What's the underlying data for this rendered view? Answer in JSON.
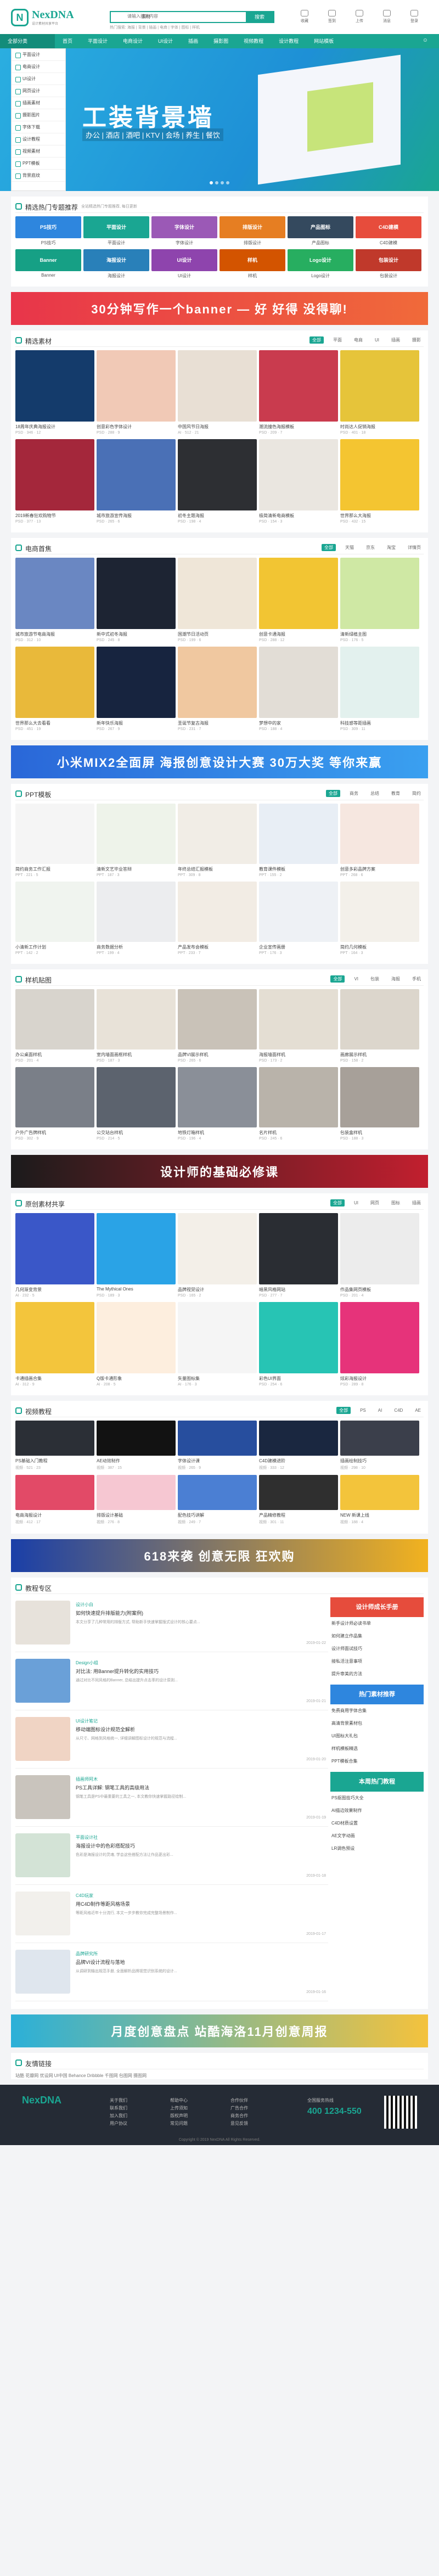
{
  "header": {
    "logo_mark": "N",
    "logo_name": "NexDNA",
    "logo_tagline": "设计素材共享平台",
    "search_category": "素材",
    "search_placeholder": "请输入搜索内容",
    "search_button": "搜索",
    "hot_words": "热门搜索: 海报 | 背景 | 插画 | 电商 | 字体 | 图标 | 样机",
    "tools": [
      "收藏",
      "签到",
      "上传",
      "消息",
      "登录"
    ]
  },
  "nav": {
    "items": [
      "全部分类",
      "首页",
      "平面设计",
      "电商设计",
      "UI设计",
      "插画",
      "摄影图",
      "视频教程",
      "设计教程",
      "网站模板"
    ],
    "right_icon": "user-icon"
  },
  "hero": {
    "dropdown": [
      "平面设计",
      "电商设计",
      "UI设计",
      "网页设计",
      "插画素材",
      "摄影图片",
      "字体下载",
      "设计教程",
      "视频素材",
      "PPT模板",
      "背景底纹"
    ],
    "title": "工装背景墙",
    "subtitle": "办公 | 酒店 | 酒吧 | KTV | 会场 | 养生 | 餐饮"
  },
  "sections": {
    "top_cats": {
      "title": "精选热门专题推荐",
      "note": "全站精选热门专题推荐, 每日更新",
      "items": [
        {
          "label": "PS技巧",
          "color": "#2e86de"
        },
        {
          "label": "平面设计",
          "color": "#1aa692"
        },
        {
          "label": "字体设计",
          "color": "#9b59b6"
        },
        {
          "label": "排版设计",
          "color": "#e67e22"
        },
        {
          "label": "产品图标",
          "color": "#34495e"
        },
        {
          "label": "C4D建模",
          "color": "#e74c3c"
        },
        {
          "label": "Banner",
          "color": "#16a085"
        },
        {
          "label": "海报设计",
          "color": "#2980b9"
        },
        {
          "label": "UI设计",
          "color": "#8e44ad"
        },
        {
          "label": "样机",
          "color": "#d35400"
        },
        {
          "label": "Logo设计",
          "color": "#27ae60"
        },
        {
          "label": "包装设计",
          "color": "#c0392b"
        }
      ]
    },
    "banner1": "30分钟写作一个banner — 好 好得 没得聊!",
    "featured": {
      "title": "精选素材",
      "tabs": [
        "全部",
        "平面",
        "电商",
        "UI",
        "插画",
        "摄影"
      ],
      "cards": [
        {
          "title": "18周年庆典海报设计",
          "meta": "PSD · 346 · 12",
          "color": "#143b6b"
        },
        {
          "title": "创意彩色字体设计",
          "meta": "PSD · 288 · 9",
          "color": "#f1c9b6"
        },
        {
          "title": "中国风节日海报",
          "meta": "AI · 512 · 21",
          "color": "#e8dfd4"
        },
        {
          "title": "潮流撞色海报模板",
          "meta": "PSD · 209 · 7",
          "color": "#c93b4e"
        },
        {
          "title": "时尚达人促销海报",
          "meta": "PSD · 401 · 18",
          "color": "#e6c43a"
        },
        {
          "title": "2019新春狂欢购物节",
          "meta": "PSD · 377 · 13",
          "color": "#a4273b"
        },
        {
          "title": "城市旅游宣传海报",
          "meta": "PSD · 265 · 6",
          "color": "#4a70b6"
        },
        {
          "title": "初冬主题海报",
          "meta": "PSD · 198 · 4",
          "color": "#2d2f33"
        },
        {
          "title": "极简清新电商模板",
          "meta": "PSD · 154 · 3",
          "color": "#eae6e0"
        },
        {
          "title": "世界那么大海报",
          "meta": "PSD · 432 · 15",
          "color": "#f4c531"
        }
      ]
    },
    "ecommerce": {
      "title": "电商首焦",
      "tabs": [
        "全部",
        "天猫",
        "京东",
        "淘宝",
        "详情页"
      ],
      "cards": [
        {
          "title": "城市旅游节电商海报",
          "meta": "PSD · 312 · 10",
          "color": "#6a87c2"
        },
        {
          "title": "新中式初冬海报",
          "meta": "PSD · 245 · 8",
          "color": "#1d2433"
        },
        {
          "title": "国潮节日活动页",
          "meta": "PSD · 199 · 6",
          "color": "#efe6d8"
        },
        {
          "title": "创意卡通海报",
          "meta": "PSD · 288 · 12",
          "color": "#f2c533"
        },
        {
          "title": "清新绿植主图",
          "meta": "PSD · 176 · 5",
          "color": "#cfe8a4"
        },
        {
          "title": "世界那么大去看看",
          "meta": "PSD · 451 · 19",
          "color": "#e9b93a"
        },
        {
          "title": "新年快乐海报",
          "meta": "PSD · 267 · 9",
          "color": "#17243f"
        },
        {
          "title": "圣诞节复古海报",
          "meta": "PSD · 231 · 7",
          "color": "#f0c8a0"
        },
        {
          "title": "梦想中的家",
          "meta": "PSD · 188 · 4",
          "color": "#e2ddd6"
        },
        {
          "title": "科技感等距插画",
          "meta": "PSD · 309 · 11",
          "color": "#e3f1ee"
        }
      ]
    },
    "banner2": "小米MIX2全面屏 海报创意设计大赛 30万大奖 等你来赢",
    "ppt": {
      "title": "PPT模板",
      "tabs": [
        "全部",
        "商务",
        "总结",
        "教育",
        "简约"
      ],
      "cards": [
        {
          "title": "简约商务工作汇报",
          "meta": "PPT · 221 · 5",
          "color": "#f5f5f5"
        },
        {
          "title": "清新文艺毕业答辩",
          "meta": "PPT · 187 · 3",
          "color": "#eef3ea"
        },
        {
          "title": "年终总结汇报模板",
          "meta": "PPT · 309 · 8",
          "color": "#f1ede6"
        },
        {
          "title": "教育课件模板",
          "meta": "PPT · 155 · 2",
          "color": "#e8eef5"
        },
        {
          "title": "创意多彩品牌方案",
          "meta": "PPT · 268 · 6",
          "color": "#f6e7e0"
        },
        {
          "title": "小清新工作计划",
          "meta": "PPT · 142 · 2",
          "color": "#f0f4ef"
        },
        {
          "title": "商务数据分析",
          "meta": "PPT · 199 · 4",
          "color": "#ecedef"
        },
        {
          "title": "产品发布会模板",
          "meta": "PPT · 233 · 7",
          "color": "#f2ece4"
        },
        {
          "title": "企业宣传画册",
          "meta": "PPT · 176 · 3",
          "color": "#eef1f5"
        },
        {
          "title": "简约几何模板",
          "meta": "PPT · 164 · 3",
          "color": "#f3f0ea"
        }
      ]
    },
    "mockup": {
      "title": "样机贴图",
      "tabs": [
        "全部",
        "VI",
        "包装",
        "海报",
        "手机"
      ],
      "cards": [
        {
          "title": "办公桌面样机",
          "meta": "PSD · 201 · 4",
          "color": "#d8d4cd"
        },
        {
          "title": "室内墙面画框样机",
          "meta": "PSD · 187 · 3",
          "color": "#e8e2d8"
        },
        {
          "title": "品牌VI展示样机",
          "meta": "PSD · 265 · 6",
          "color": "#c9c2b8"
        },
        {
          "title": "海报墙面样机",
          "meta": "PSD · 173 · 2",
          "color": "#e4ded3"
        },
        {
          "title": "画廊展示样机",
          "meta": "PSD · 158 · 2",
          "color": "#dcd6cc"
        },
        {
          "title": "户外广告牌样机",
          "meta": "PSD · 302 · 9",
          "color": "#7a7f88"
        },
        {
          "title": "公交站台样机",
          "meta": "PSD · 214 · 5",
          "color": "#5c636e"
        },
        {
          "title": "地铁灯箱样机",
          "meta": "PSD · 196 · 4",
          "color": "#8a8f98"
        },
        {
          "title": "名片样机",
          "meta": "PSD · 245 · 6",
          "color": "#b9b3aa"
        },
        {
          "title": "包装盒样机",
          "meta": "PSD · 188 · 3",
          "color": "#a7a099"
        }
      ]
    },
    "banner3": "设计师的基础必修课",
    "design_share": {
      "title": "原创素材共享",
      "tabs": [
        "全部",
        "UI",
        "网页",
        "图标",
        "插画"
      ],
      "cards": [
        {
          "title": "几何渐变背景",
          "meta": "AI · 232 · 5",
          "color": "#3a57c8"
        },
        {
          "title": "The Mythical Ones",
          "meta": "PSD · 189 · 3",
          "color": "#2aa3e6"
        },
        {
          "title": "品牌视觉设计",
          "meta": "PSD · 165 · 2",
          "color": "#f3efe8"
        },
        {
          "title": "暗黑风格网站",
          "meta": "PSD · 277 · 7",
          "color": "#2a2d33"
        },
        {
          "title": "作品集网页模板",
          "meta": "PSD · 201 · 4",
          "color": "#ececec"
        },
        {
          "title": "卡通插画合集",
          "meta": "AI · 312 · 9",
          "color": "#f3c53c"
        },
        {
          "title": "Q版卡通形象",
          "meta": "AI · 208 · 5",
          "color": "#fdeede"
        },
        {
          "title": "矢量图标集",
          "meta": "AI · 176 · 3",
          "color": "#f5f5f5"
        },
        {
          "title": "彩色UI界面",
          "meta": "PSD · 254 · 6",
          "color": "#27c4b4"
        },
        {
          "title": "炫彩海报设计",
          "meta": "PSD · 289 · 8",
          "color": "#e6337a"
        }
      ]
    },
    "video": {
      "title": "视频教程",
      "tabs": [
        "全部",
        "PS",
        "AI",
        "C4D",
        "AE"
      ],
      "cards": [
        {
          "title": "PS基础入门教程",
          "meta": "视频 · 521 · 23",
          "color": "#2b2f36"
        },
        {
          "title": "AE动效制作",
          "meta": "视频 · 387 · 15",
          "color": "#121212"
        },
        {
          "title": "字体设计课",
          "meta": "视频 · 265 · 9",
          "color": "#274e9e"
        },
        {
          "title": "C4D建模进阶",
          "meta": "视频 · 333 · 12",
          "color": "#1a2740"
        },
        {
          "title": "插画绘制技巧",
          "meta": "视频 · 298 · 10",
          "color": "#3b3f4b"
        },
        {
          "title": "电商海报设计",
          "meta": "视频 · 412 · 17",
          "color": "#e24a67"
        },
        {
          "title": "排版设计基础",
          "meta": "视频 · 276 · 8",
          "color": "#f6c7d2"
        },
        {
          "title": "配色技巧讲解",
          "meta": "视频 · 249 · 7",
          "color": "#4b7fd3"
        },
        {
          "title": "产品精修教程",
          "meta": "视频 · 301 · 11",
          "color": "#2f2f2f"
        },
        {
          "title": "NEW 新课上线",
          "meta": "视频 · 188 · 4",
          "color": "#f3c43b"
        }
      ]
    },
    "banner4": "618来袭 创意无限 狂欢购",
    "teaching": {
      "title": "教程专区",
      "posts": [
        {
          "author": "设计小白",
          "title": "如何快速提升排版能力(附案例)",
          "meta": "本文分享了几种常用的排版方式, 帮助新手快速掌握版式设计的核心要点...",
          "date": "2019-01-22",
          "color": "#e7e2db"
        },
        {
          "author": "Design小组",
          "title": "对比法: 用Banner提升转化的实用技巧",
          "meta": "通过对比不同风格的Banner, 总结出提升点击率的设计原则...",
          "date": "2019-01-21",
          "color": "#6aa0d8"
        },
        {
          "author": "UI设计笔记",
          "title": "移动端图标设计规范全解析",
          "meta": "从尺寸、网格到风格统一, 详细讲解图标设计的规范与流程...",
          "date": "2019-01-20",
          "color": "#f0d4c4"
        },
        {
          "author": "插画师阿木",
          "title": "PS工具详解: 钢笔工具的高级用法",
          "meta": "钢笔工具是PS中最重要的工具之一, 本文教你快速掌握路径绘制...",
          "date": "2019-01-19",
          "color": "#c9c4bd"
        },
        {
          "author": "平面设计社",
          "title": "海报设计中的色彩搭配技巧",
          "meta": "色彩是海报设计的灵魂, 学会这些搭配方法让作品更出彩...",
          "date": "2019-01-18",
          "color": "#d3e3d6"
        },
        {
          "author": "C4D玩家",
          "title": "用C4D制作等距风格场景",
          "meta": "等距风格近年十分流行, 本文一步步教你完成完整场景制作...",
          "date": "2019-01-17",
          "color": "#f2f0ec"
        },
        {
          "author": "品牌研究所",
          "title": "品牌VI设计流程与落地",
          "meta": "从调研到输出规范手册, 全面解析品牌视觉识别系统的设计...",
          "date": "2019-01-16",
          "color": "#dfe6ee"
        }
      ],
      "side": [
        {
          "head": "设计师成长手册",
          "list": [
            "新手设计师必读书单",
            "如何建立作品集",
            "设计师面试技巧",
            "接私活注意事项",
            "提升审美的方法"
          ],
          "color": "#e64c3c"
        },
        {
          "head": "热门素材推荐",
          "list": [
            "免费商用字体合集",
            "高清背景素材包",
            "UI图标大礼包",
            "样机模板精选",
            "PPT模板合集"
          ],
          "color": "#2e86de"
        },
        {
          "head": "本周热门教程",
          "list": [
            "PS抠图技巧大全",
            "AI描边效果制作",
            "C4D材质设置",
            "AE文字动画",
            "LR调色预设"
          ],
          "color": "#1aa692"
        }
      ]
    },
    "banner5": "月度创意盘点 站酷海洛11月创意周报",
    "links": {
      "title": "友情链接",
      "text": "站酷  花瓣网  优设网  UI中国  Behance  Dribbble  千图网  包图网  摄图网"
    }
  },
  "footer": {
    "logo": "NexDNA",
    "cols": [
      [
        "关于我们",
        "联系我们",
        "加入我们",
        "用户协议"
      ],
      [
        "帮助中心",
        "上传须知",
        "版权声明",
        "常见问题"
      ],
      [
        "合作伙伴",
        "广告合作",
        "商务合作",
        "意见反馈"
      ]
    ],
    "tel_label": "全国服务热线",
    "tel": "400 1234-550",
    "copyright": "Copyright © 2019 NexDNA All Rights Reserved."
  }
}
